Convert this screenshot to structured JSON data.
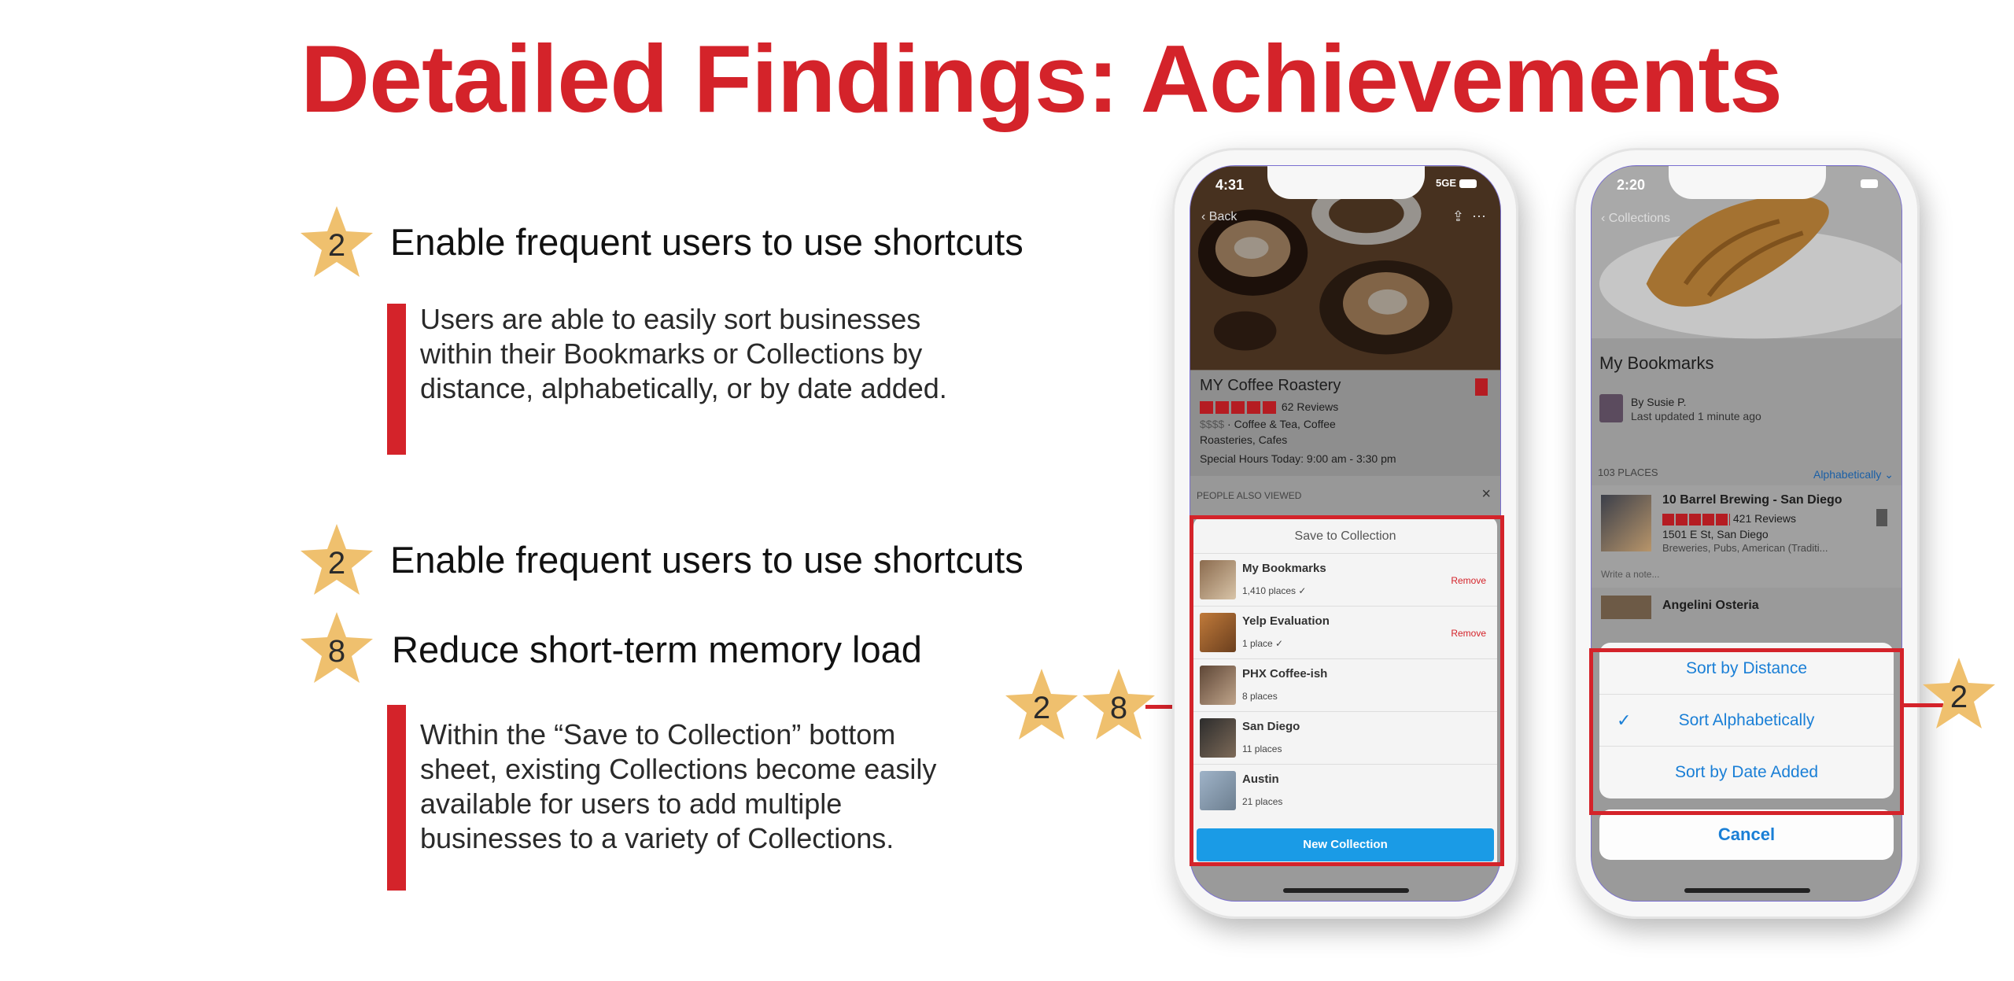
{
  "slide": {
    "title": "Detailed Findings: Achievements"
  },
  "colors": {
    "accent": "#d4232a",
    "star": "#efc06e",
    "link": "#1a7fd6"
  },
  "findings": [
    {
      "badges": [
        "2"
      ],
      "heading": "Enable frequent users to use shortcuts",
      "description": [
        "Users are able to easily sort businesses",
        "within their Bookmarks or Collections by",
        "distance, alphabetically, or by date added."
      ]
    },
    {
      "badges": [
        "2"
      ],
      "heading": "Enable frequent users to use shortcuts"
    },
    {
      "badges": [
        "8"
      ],
      "heading": "Reduce short-term memory load",
      "description": [
        "Within the “Save to Collection” bottom",
        "sheet, existing Collections become easily",
        "available for users to add multiple",
        "businesses to a variety of Collections."
      ]
    }
  ],
  "callouts": {
    "left": [
      "2",
      "8"
    ],
    "right": [
      "2"
    ]
  },
  "phone1": {
    "time": "4:31",
    "signal": "5GE",
    "back": "Back",
    "business": {
      "name": "MY Coffee Roastery",
      "reviews": "62 Reviews",
      "price": "$$$$",
      "category_line1": "Coffee & Tea, Coffee",
      "category_line2": "Roasteries, Cafes",
      "hours": "Special Hours Today: 9:00 am - 3:30 pm"
    },
    "people_also_viewed": "PEOPLE ALSO VIEWED",
    "close": "×",
    "sheet": {
      "title": "Save to Collection",
      "collections": [
        {
          "name": "My Bookmarks",
          "count": "1,410 places ✓",
          "action": "Remove"
        },
        {
          "name": "Yelp Evaluation",
          "count": "1 place ✓",
          "action": "Remove"
        },
        {
          "name": "PHX Coffee-ish",
          "count": "8 places",
          "action": ""
        },
        {
          "name": "San Diego",
          "count": "11 places",
          "action": ""
        },
        {
          "name": "Austin",
          "count": "21 places",
          "action": ""
        }
      ],
      "new_button": "New Collection"
    }
  },
  "phone2": {
    "time": "2:20",
    "back": "Collections",
    "list_title": "My Bookmarks",
    "owner": "By Susie P.",
    "updated": "Last updated 1 minute ago",
    "places_count": "103 PLACES",
    "sort_label": "Alphabetically ⌄",
    "place": {
      "name": "10 Barrel Brewing - San Diego",
      "reviews": "421 Reviews",
      "address": "1501 E St, San Diego",
      "category": "Breweries, Pubs, American (Traditi..."
    },
    "note_placeholder": "Write a note...",
    "next_place": "Angelini Osteria",
    "actions": [
      "Sort by Distance",
      "Sort Alphabetically",
      "Sort by Date Added"
    ],
    "cancel": "Cancel"
  }
}
